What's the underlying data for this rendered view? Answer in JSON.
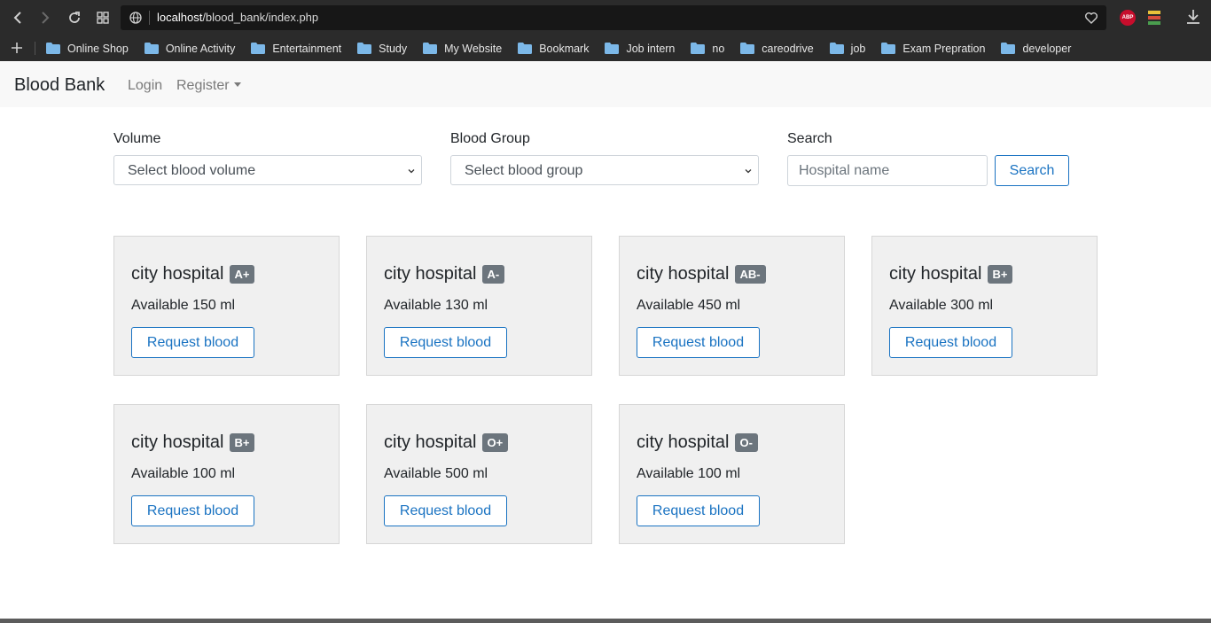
{
  "browser": {
    "url_host": "localhost",
    "url_path": "/blood_bank/index.php",
    "bookmarks": [
      "Online Shop",
      "Online Activity",
      "Entertainment",
      "Study",
      "My Website",
      "Bookmark",
      "Job intern",
      "no",
      "careodrive",
      "job",
      "Exam Prepration",
      "developer"
    ],
    "extension_abp_label": "ABP"
  },
  "navbar": {
    "brand": "Blood Bank",
    "login": "Login",
    "register": "Register"
  },
  "filters": {
    "volume_label": "Volume",
    "volume_selected": "Select blood volume",
    "group_label": "Blood Group",
    "group_selected": "Select blood group",
    "search_label": "Search",
    "search_placeholder": "Hospital name",
    "search_button": "Search"
  },
  "cards": [
    {
      "hospital": "city hospital",
      "group": "A+",
      "available": "Available 150 ml",
      "button": "Request blood"
    },
    {
      "hospital": "city hospital",
      "group": "A-",
      "available": "Available 130 ml",
      "button": "Request blood"
    },
    {
      "hospital": "city hospital",
      "group": "AB-",
      "available": "Available 450 ml",
      "button": "Request blood"
    },
    {
      "hospital": "city hospital",
      "group": "B+",
      "available": "Available 300 ml",
      "button": "Request blood"
    },
    {
      "hospital": "city hospital",
      "group": "B+",
      "available": "Available 100 ml",
      "button": "Request blood"
    },
    {
      "hospital": "city hospital",
      "group": "O+",
      "available": "Available 500 ml",
      "button": "Request blood"
    },
    {
      "hospital": "city hospital",
      "group": "O-",
      "available": "Available 100 ml",
      "button": "Request blood"
    }
  ],
  "colors": {
    "accent": "#1a73c2",
    "badge": "#6c757d",
    "card_bg": "#f0f0f0",
    "navbar_bg": "#f8f8f8"
  }
}
